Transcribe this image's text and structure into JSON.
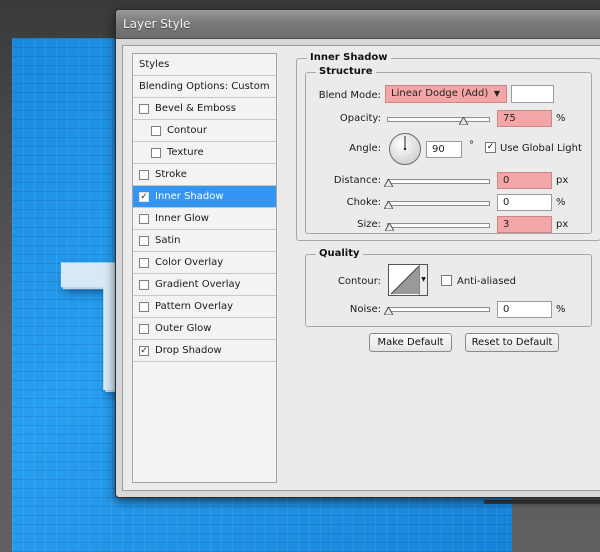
{
  "dialog": {
    "title": "Layer Style"
  },
  "style_list": {
    "items": [
      {
        "label": "Styles",
        "checkbox": false,
        "checked": false,
        "indent": 0,
        "selected": false
      },
      {
        "label": "Blending Options: Custom",
        "checkbox": false,
        "checked": false,
        "indent": 0,
        "selected": false
      },
      {
        "label": "Bevel & Emboss",
        "checkbox": true,
        "checked": false,
        "indent": 0,
        "selected": false
      },
      {
        "label": "Contour",
        "checkbox": true,
        "checked": false,
        "indent": 1,
        "selected": false
      },
      {
        "label": "Texture",
        "checkbox": true,
        "checked": false,
        "indent": 1,
        "selected": false
      },
      {
        "label": "Stroke",
        "checkbox": true,
        "checked": false,
        "indent": 0,
        "selected": false
      },
      {
        "label": "Inner Shadow",
        "checkbox": true,
        "checked": true,
        "indent": 0,
        "selected": true
      },
      {
        "label": "Inner Glow",
        "checkbox": true,
        "checked": false,
        "indent": 0,
        "selected": false
      },
      {
        "label": "Satin",
        "checkbox": true,
        "checked": false,
        "indent": 0,
        "selected": false
      },
      {
        "label": "Color Overlay",
        "checkbox": true,
        "checked": false,
        "indent": 0,
        "selected": false
      },
      {
        "label": "Gradient Overlay",
        "checkbox": true,
        "checked": false,
        "indent": 0,
        "selected": false
      },
      {
        "label": "Pattern Overlay",
        "checkbox": true,
        "checked": false,
        "indent": 0,
        "selected": false
      },
      {
        "label": "Outer Glow",
        "checkbox": true,
        "checked": false,
        "indent": 0,
        "selected": false
      },
      {
        "label": "Drop Shadow",
        "checkbox": true,
        "checked": true,
        "indent": 0,
        "selected": false
      }
    ]
  },
  "inner_shadow": {
    "section_title": "Inner Shadow",
    "structure": {
      "title": "Structure",
      "blend_mode_label": "Blend Mode:",
      "blend_mode_value": "Linear Dodge (Add)",
      "swatch_color": "#ffffff",
      "opacity_label": "Opacity:",
      "opacity_value": "75",
      "opacity_unit": "%",
      "opacity_level": 0.75,
      "angle_label": "Angle:",
      "angle_value": "90",
      "angle_unit": "°",
      "use_global_light_label": "Use Global Light",
      "use_global_light_checked": true,
      "distance_label": "Distance:",
      "distance_value": "0",
      "distance_unit": "px",
      "distance_level": 0.0,
      "choke_label": "Choke:",
      "choke_value": "0",
      "choke_unit": "%",
      "choke_level": 0.0,
      "size_label": "Size:",
      "size_value": "3",
      "size_unit": "px",
      "size_level": 0.012
    },
    "quality": {
      "title": "Quality",
      "contour_label": "Contour:",
      "anti_aliased_label": "Anti-aliased",
      "anti_aliased_checked": false,
      "noise_label": "Noise:",
      "noise_value": "0",
      "noise_unit": "%",
      "noise_level": 0.0
    },
    "buttons": {
      "make_default": "Make Default",
      "reset_default": "Reset to Default"
    }
  },
  "colors": {
    "selection": "#3495f4",
    "highlight_field": "#f4a6a6",
    "canvas_blue": "#1d9af0"
  },
  "canvas": {
    "letter": "T"
  }
}
